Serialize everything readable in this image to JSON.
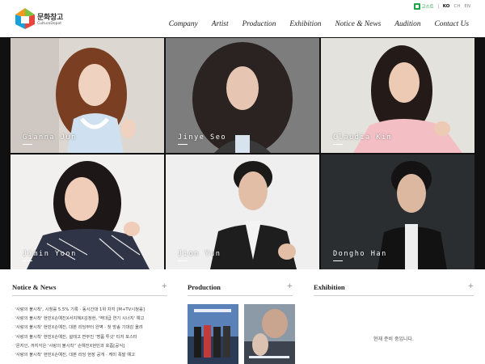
{
  "brand": {
    "logo_text": "문화창고",
    "logo_sub": "CultureDepot"
  },
  "util": {
    "ticket_label": "고스트",
    "languages": [
      {
        "label": "KO",
        "active": true
      },
      {
        "label": "CH",
        "active": false
      },
      {
        "label": "EN",
        "active": false
      }
    ]
  },
  "nav": {
    "items": [
      "Company",
      "Artist",
      "Production",
      "Exhibition",
      "Notice & News",
      "Audition",
      "Contact Us"
    ]
  },
  "artists": [
    {
      "name": "Gianna Jun"
    },
    {
      "name": "Jinye Seo"
    },
    {
      "name": "Claudia Kim"
    },
    {
      "name": "Jimin Yoon"
    },
    {
      "name": "Jion Yun"
    },
    {
      "name": "Dongho Han"
    }
  ],
  "notice": {
    "title": "Notice & News",
    "plus": "+",
    "items": [
      "'사랑의 불시착', 시청률 5.5% 기록 · 동시간대 1위 차지 [M+TV시청률]",
      "'사랑의 불시착' 현빈X손예진X서지혜X김정현, '역대급 연기 시너지' 예고",
      "'사랑의 불시착' 현빈X손예진, 대본 리딩부터 완벽 · 첫 방송 기대감 올려",
      "'사랑의 불시착' 현빈X손예진, 설레고 짠무진 '명품 투샷' 티저 포스터",
      "'몬지인, 까지각은 '사랑의 불시착'' 손예진X현빈과 호흡[공식]",
      "'사랑의 불시착' 현빈X손예진, 대본 리딩 현장 공개 · 케미 폭발 예고"
    ]
  },
  "production": {
    "title": "Production",
    "plus": "+"
  },
  "exhibition": {
    "title": "Exhibition",
    "plus": "+",
    "empty_text": "현재 준비 중입니다."
  },
  "colors": {
    "accent_green": "#22a34a",
    "logo_orange": "#f29a1f",
    "logo_green": "#7cc242",
    "logo_blue": "#1aa0d8"
  }
}
